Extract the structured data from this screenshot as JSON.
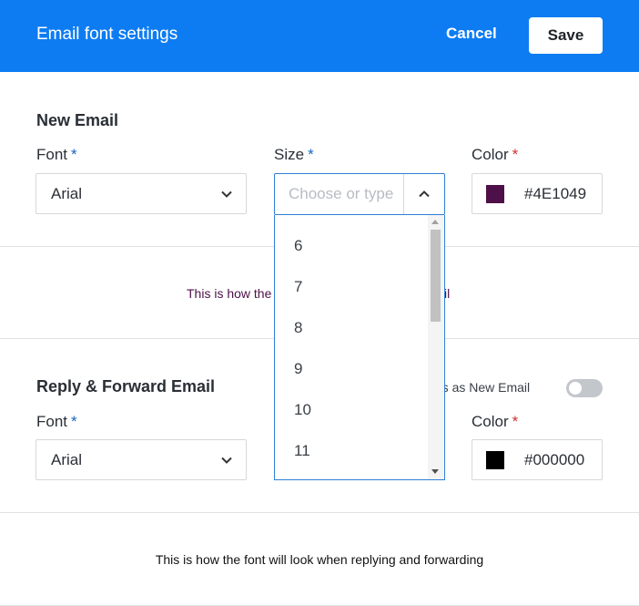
{
  "header": {
    "title": "Email font settings",
    "cancel_label": "Cancel",
    "save_label": "Save"
  },
  "new_email": {
    "title": "New Email",
    "font_label": "Font",
    "size_label": "Size",
    "color_label": "Color",
    "required_mark": "*",
    "font_value": "Arial",
    "size_placeholder": "Choose or type",
    "color_value": "#4E1049",
    "color_swatch": "#4E1049",
    "preview_left": "This is how the",
    "preview_right": "il",
    "preview_color": "#4E1049"
  },
  "reply_email": {
    "title": "Reply & Forward Email",
    "same_settings_label": "ings as New Email",
    "font_label": "Font",
    "color_label": "Color",
    "required_mark": "*",
    "font_value": "Arial",
    "color_value": "#000000",
    "color_swatch": "#000000",
    "preview": "This is how the font will look when replying and forwarding"
  },
  "size_dropdown": {
    "options": [
      "6",
      "7",
      "8",
      "9",
      "10",
      "11"
    ]
  },
  "colors": {
    "accent": "#0D7CF2",
    "focus_border": "#2E7FD6",
    "divider": "#DFE2E5"
  }
}
